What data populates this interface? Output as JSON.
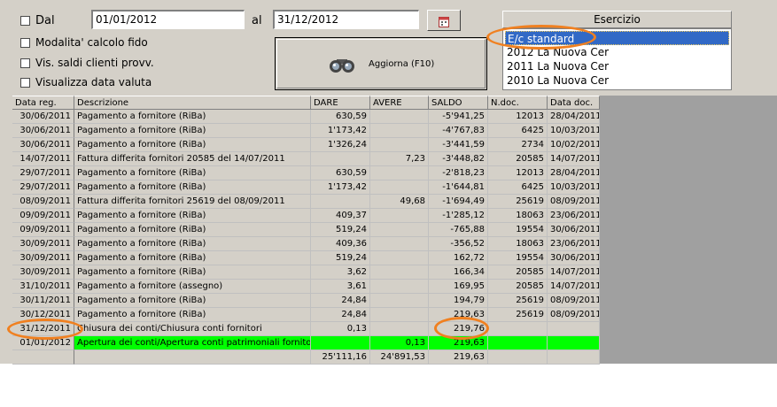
{
  "filters": {
    "dal_label": "Dal",
    "dal_value": "01/01/2012",
    "al_label": "al",
    "al_value": "31/12/2012",
    "opt1_label": "Modalita' calcolo fido",
    "opt2_label": "Vis. saldi clienti provv.",
    "opt3_label": "Visualizza data valuta"
  },
  "toolbar": {
    "aggiorna_label": "Aggiorna (F10)"
  },
  "esercizio": {
    "header": "Esercizio",
    "items": [
      "E/c standard",
      "2012 La Nuova Cer",
      "2011 La Nuova Cer",
      "2010 La Nuova Cer"
    ],
    "selected": 0
  },
  "colors": {
    "highlight_row": "#00ff00",
    "annotation": "#f08020",
    "selection": "#3169c6"
  },
  "table": {
    "headers": [
      "Data reg.",
      "Descrizione",
      "DARE",
      "AVERE",
      "SALDO",
      "N.doc.",
      "Data doc."
    ],
    "rows": [
      [
        "30/06/2011",
        "Pagamento a fornitore (RiBa)",
        "630,59",
        "",
        "-5'941,25",
        "12013",
        "28/04/2011"
      ],
      [
        "30/06/2011",
        "Pagamento a fornitore (RiBa)",
        "1'173,42",
        "",
        "-4'767,83",
        "6425",
        "10/03/2011"
      ],
      [
        "30/06/2011",
        "Pagamento a fornitore (RiBa)",
        "1'326,24",
        "",
        "-3'441,59",
        "2734",
        "10/02/2011"
      ],
      [
        "14/07/2011",
        "Fattura differita fornitori 20585 del 14/07/2011",
        "",
        "7,23",
        "-3'448,82",
        "20585",
        "14/07/2011"
      ],
      [
        "29/07/2011",
        "Pagamento a fornitore (RiBa)",
        "630,59",
        "",
        "-2'818,23",
        "12013",
        "28/04/2011"
      ],
      [
        "29/07/2011",
        "Pagamento a fornitore (RiBa)",
        "1'173,42",
        "",
        "-1'644,81",
        "6425",
        "10/03/2011"
      ],
      [
        "08/09/2011",
        "Fattura differita fornitori 25619 del 08/09/2011",
        "",
        "49,68",
        "-1'694,49",
        "25619",
        "08/09/2011"
      ],
      [
        "09/09/2011",
        "Pagamento a fornitore (RiBa)",
        "409,37",
        "",
        "-1'285,12",
        "18063",
        "23/06/2011"
      ],
      [
        "09/09/2011",
        "Pagamento a fornitore (RiBa)",
        "519,24",
        "",
        "-765,88",
        "19554",
        "30/06/2011"
      ],
      [
        "30/09/2011",
        "Pagamento a fornitore (RiBa)",
        "409,36",
        "",
        "-356,52",
        "18063",
        "23/06/2011"
      ],
      [
        "30/09/2011",
        "Pagamento a fornitore (RiBa)",
        "519,24",
        "",
        "162,72",
        "19554",
        "30/06/2011"
      ],
      [
        "30/09/2011",
        "Pagamento a fornitore (RiBa)",
        "3,62",
        "",
        "166,34",
        "20585",
        "14/07/2011"
      ],
      [
        "31/10/2011",
        "Pagamento a fornitore (assegno)",
        "3,61",
        "",
        "169,95",
        "20585",
        "14/07/2011"
      ],
      [
        "30/11/2011",
        "Pagamento a fornitore (RiBa)",
        "24,84",
        "",
        "194,79",
        "25619",
        "08/09/2011"
      ],
      [
        "30/12/2011",
        "Pagamento a fornitore (RiBa)",
        "24,84",
        "",
        "219,63",
        "25619",
        "08/09/2011"
      ],
      [
        "31/12/2011",
        "Chiusura dei conti/Chiusura conti fornitori",
        "0,13",
        "",
        "219,76",
        "",
        ""
      ],
      [
        "01/01/2012",
        "Apertura dei conti/Apertura conti patrimoniali fornitori",
        "",
        "0,13",
        "219,63",
        "",
        ""
      ],
      [
        "",
        "",
        "25'111,16",
        "24'891,53",
        "219,63",
        "",
        ""
      ]
    ]
  }
}
